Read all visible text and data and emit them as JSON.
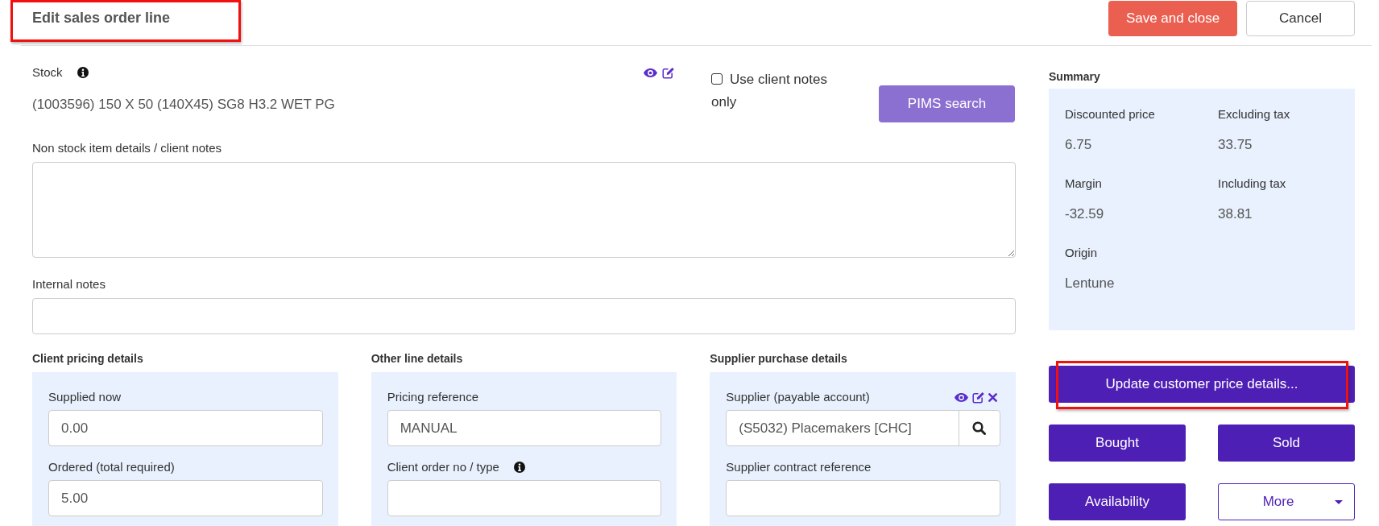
{
  "header": {
    "title": "Edit sales order line",
    "highlighted": true,
    "buttons": [
      {
        "label": "Save and close",
        "kind": "primary"
      },
      {
        "label": "Cancel",
        "kind": "secondary"
      }
    ]
  },
  "stock": {
    "label": "Stock",
    "info": true,
    "value": "(1003596) 150 X 50 (140X45) SG8 H3.2 WET PG"
  },
  "client_notes_option": {
    "label": "Use client notes only",
    "checked": false
  },
  "pims_search": {
    "label": "PIMS search"
  },
  "client_notes": {
    "label": "Non stock item details / client notes"
  },
  "internal_notes": {
    "label": "Internal notes"
  },
  "sections": [
    {
      "title": "Client pricing details",
      "fields": [
        {
          "label": "Supplied now",
          "kind": "text",
          "info": false,
          "value": "0.00"
        },
        {
          "label": "Ordered (total required)",
          "kind": "text",
          "info": false,
          "value": "5.00"
        }
      ]
    },
    {
      "title": "Other line details",
      "fields": [
        {
          "label": "Pricing reference",
          "kind": "text",
          "info": false,
          "value": "MANUAL"
        },
        {
          "label": "Client order no / type",
          "kind": "text",
          "info": true
        }
      ]
    },
    {
      "title": "Supplier purchase details",
      "fields": [
        {
          "label": "Supplier (payable account)",
          "kind": "lookup",
          "info": false,
          "value": "(S5032) Placemakers [CHC]"
        },
        {
          "label": "Supplier contract reference",
          "kind": "text",
          "info": false
        }
      ]
    }
  ],
  "summary": {
    "title": "Summary",
    "items": [
      {
        "label": "Discounted price",
        "value": "6.75"
      },
      {
        "label": "Excluding tax",
        "value": "33.75"
      },
      {
        "label": "Margin",
        "value": "-32.59"
      },
      {
        "label": "Including tax",
        "value": "38.81"
      },
      {
        "label": "Origin",
        "value": "Lentune"
      }
    ]
  },
  "actions": [
    {
      "label": "Update customer price details...",
      "kind": "wide",
      "highlighted": true
    },
    {
      "label": "Bought",
      "kind": "action",
      "highlighted": false
    },
    {
      "label": "Sold",
      "kind": "action",
      "highlighted": false
    },
    {
      "label": "Availability",
      "kind": "action",
      "highlighted": false
    },
    {
      "label": "More",
      "kind": "dropdown",
      "highlighted": false
    }
  ]
}
